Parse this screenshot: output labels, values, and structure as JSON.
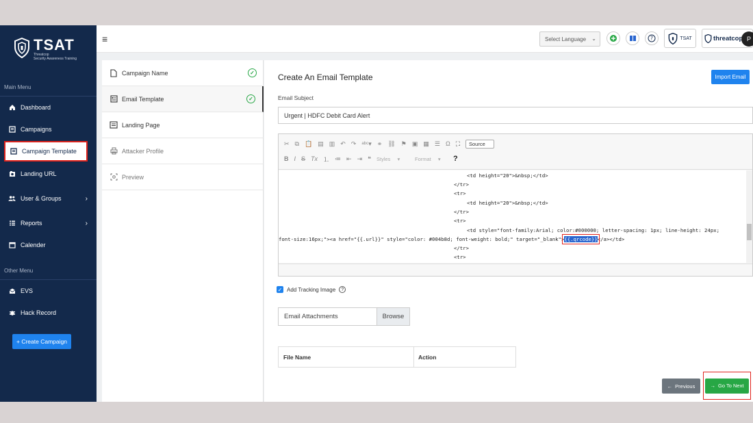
{
  "brand": {
    "name": "TSAT",
    "sub1": "Threatcop",
    "sub2": "Security Awareness Training"
  },
  "sidebar": {
    "main_menu_label": "Main Menu",
    "other_menu_label": "Other Menu",
    "items": [
      {
        "label": "Dashboard",
        "icon": "home-icon"
      },
      {
        "label": "Campaigns",
        "icon": "campaigns-icon"
      },
      {
        "label": "Campaign Template",
        "icon": "template-icon",
        "active": true
      },
      {
        "label": "Landing URL",
        "icon": "landing-url-icon"
      },
      {
        "label": "User & Groups",
        "icon": "users-icon",
        "has_children": true
      },
      {
        "label": "Reports",
        "icon": "reports-icon",
        "has_children": true
      },
      {
        "label": "Calender",
        "icon": "calendar-icon"
      }
    ],
    "other_items": [
      {
        "label": "EVS",
        "icon": "mail-icon"
      },
      {
        "label": "Hack Record",
        "icon": "bug-icon"
      }
    ],
    "create_button": "+ Create Campaign"
  },
  "topbar": {
    "language_select": "Select Language",
    "tsat_badge": "TSAT",
    "threatcop_label": "threatcop",
    "avatar_initial": "P"
  },
  "steps": [
    {
      "label": "Campaign Name",
      "done": true
    },
    {
      "label": "Email Template",
      "done": true
    },
    {
      "label": "Landing Page",
      "done": false
    },
    {
      "label": "Attacker Profile",
      "done": false
    },
    {
      "label": "Preview",
      "done": false
    }
  ],
  "main": {
    "title": "Create An Email Template",
    "import_button": "Import Email",
    "subject_label": "Email Subject",
    "subject_value": "Urgent | HDFC Debit Card Alert",
    "toolbar": {
      "source_label": "Source",
      "styles_label": "Styles",
      "format_label": "Format",
      "help": "?"
    },
    "code": {
      "line1": "<td height=\"20\">&nbsp;</td>",
      "line2": "</tr>",
      "line3": "<tr>",
      "line4": "<td height=\"20\">&nbsp;</td>",
      "line5": "</tr>",
      "line6": "<tr>",
      "line7": "<td style=\"font-family:Arial; color:#000000; letter-spacing: 1px; line-height: 24px;",
      "line8a": "font-size:16px;\"><a href=\"{{.url}}\" style=\"color: #004b8d; font-weight: bold;\" target=\"_blank\">",
      "line8_sel": "{{.qrcode}}",
      "line8b": "</a></td>",
      "line9": "</tr>",
      "line10": "<tr>"
    },
    "tracking_label": "Add Tracking Image",
    "attachments_label": "Email Attachments",
    "browse_label": "Browse",
    "table_headers": [
      "File Name",
      "Action"
    ],
    "previous_button": "Previous",
    "next_button": "Go To Next"
  },
  "colors": {
    "sidebar": "#13294b",
    "accent": "#1f83ee",
    "success": "#27a745",
    "highlight": "#e0221b"
  }
}
